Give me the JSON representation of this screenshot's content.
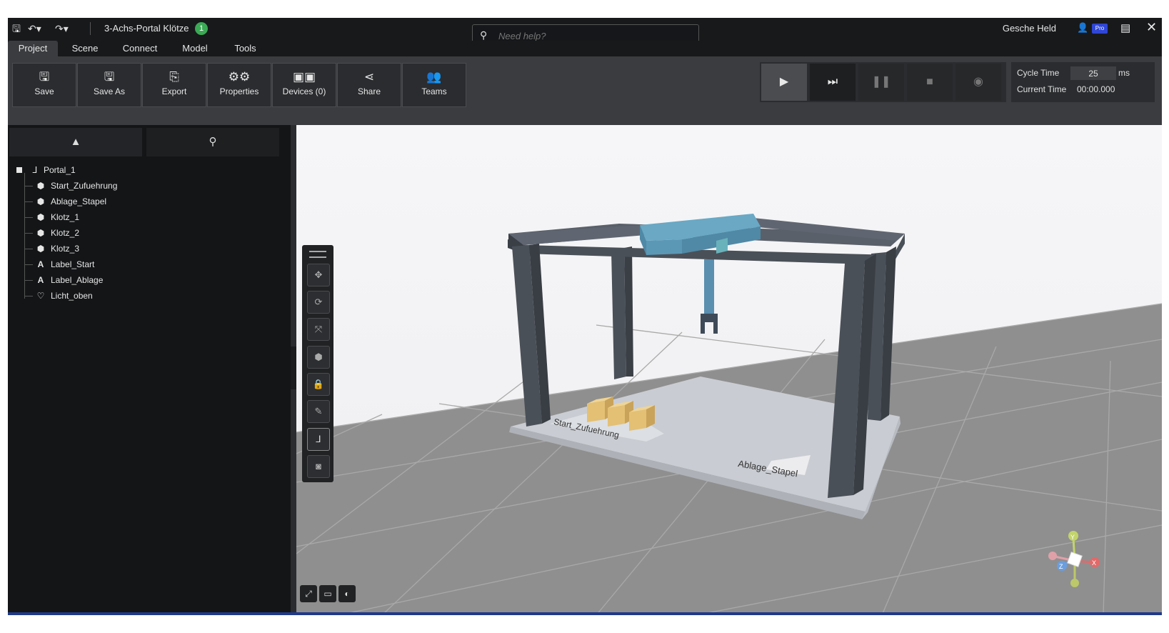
{
  "title_bar": {
    "project_title": "3-Achs-Portal Klötze",
    "project_badge": "1",
    "help_placeholder": "Need help?",
    "user_name": "Gesche Held",
    "user_badge": "Pro",
    "icons": [
      "save-icon",
      "undo-icon",
      "redo-icon",
      "search-icon",
      "user-icon",
      "window-icon",
      "close-icon"
    ]
  },
  "menu": {
    "tabs": [
      {
        "label": "Project",
        "active": true
      },
      {
        "label": "Scene",
        "active": false
      },
      {
        "label": "Connect",
        "active": false
      },
      {
        "label": "Model",
        "active": false
      },
      {
        "label": "Tools",
        "active": false
      }
    ]
  },
  "toolbar": {
    "buttons": [
      {
        "label": "Save",
        "icon": "save-icon"
      },
      {
        "label": "Save As",
        "icon": "save-as-icon"
      },
      {
        "label": "Export",
        "icon": "export-icon"
      },
      {
        "label": "Properties",
        "icon": "properties-icon"
      },
      {
        "label": "Devices (0)",
        "icon": "devices-icon"
      },
      {
        "label": "Share",
        "icon": "share-icon"
      },
      {
        "label": "Teams",
        "icon": "teams-icon"
      }
    ],
    "simulation": {
      "buttons": [
        "play-icon",
        "step-icon",
        "pause-icon",
        "stop-icon",
        "record-icon"
      ],
      "cycle_time_label": "Cycle Time",
      "cycle_time_value": "25",
      "cycle_time_unit": "ms",
      "current_time_label": "Current Time",
      "current_time_value": "00:00.000"
    }
  },
  "left_panel": {
    "tabs": [
      "hierarchy-icon",
      "search-icon"
    ],
    "tree": [
      {
        "label": "Portal_1",
        "icon": "portal-icon",
        "root": true
      },
      {
        "label": "Start_Zufuehrung",
        "icon": "cube-icon"
      },
      {
        "label": "Ablage_Stapel",
        "icon": "cube-icon"
      },
      {
        "label": "Klotz_1",
        "icon": "cube-icon"
      },
      {
        "label": "Klotz_2",
        "icon": "cube-icon"
      },
      {
        "label": "Klotz_3",
        "icon": "cube-icon"
      },
      {
        "label": "Label_Start",
        "icon": "text-icon"
      },
      {
        "label": "Label_Ablage",
        "icon": "text-icon"
      },
      {
        "label": "Licht_oben",
        "icon": "light-icon"
      }
    ]
  },
  "viewport": {
    "labels": {
      "start": "Start_Zufuehrung",
      "ablage": "Ablage_Stapel"
    },
    "gizmo_axes": {
      "y": "Y",
      "x": "X",
      "z": "Z"
    },
    "tools": [
      "move-icon",
      "rotate-icon",
      "scale-icon",
      "cube-view-icon",
      "lock-icon",
      "paint-icon",
      "portal-icon",
      "camera-icon"
    ],
    "bottom_tools": [
      "fullscreen-icon",
      "vr-icon",
      "contrast-icon"
    ],
    "colors": {
      "frame": "#4a5058",
      "beam": "#6aa8c4",
      "floor": "#8f8f8f",
      "platform": "#c9ccd2",
      "box": "#e3c074"
    }
  }
}
